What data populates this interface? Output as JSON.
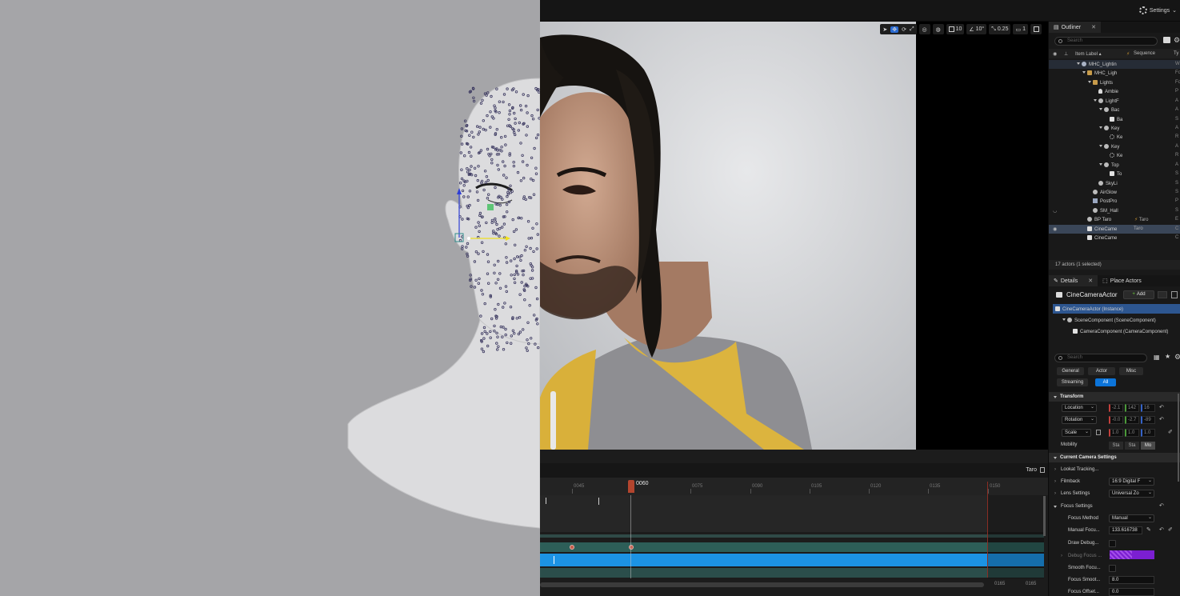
{
  "topbar": {
    "settings_label": "Settings"
  },
  "viewport": {
    "toolbar": {
      "grid_snap": "10",
      "rotate_snap": "10°",
      "scale_snap": "0.25",
      "camera_speed": "1"
    }
  },
  "sequencer": {
    "sequence_name": "Taro",
    "current_frame": "0060",
    "ticks": [
      "0045",
      "0075",
      "0090",
      "0105",
      "0120",
      "0135",
      "0150"
    ],
    "end_left": "0165",
    "end_right": "0165"
  },
  "outliner": {
    "tab_label": "Outliner",
    "search_placeholder": "Search",
    "col_item_label": "Item Label ▴",
    "col_sequence": "Sequence",
    "col_type": "Ty",
    "rows": [
      {
        "label": "MHC_Lightin",
        "type": "W",
        "seq": ""
      },
      {
        "label": "MHC_Ligh",
        "type": "Fo",
        "seq": ""
      },
      {
        "label": "Lights",
        "type": "Fo",
        "seq": ""
      },
      {
        "label": "Ambie",
        "type": "P",
        "seq": ""
      },
      {
        "label": "LightF",
        "type": "A",
        "seq": ""
      },
      {
        "label": "Bac",
        "type": "A",
        "seq": ""
      },
      {
        "label": "Ba",
        "type": "S",
        "seq": ""
      },
      {
        "label": "Key",
        "type": "A",
        "seq": ""
      },
      {
        "label": "Ke",
        "type": "R",
        "seq": ""
      },
      {
        "label": "Key",
        "type": "A",
        "seq": ""
      },
      {
        "label": "Ke",
        "type": "R",
        "seq": ""
      },
      {
        "label": "Top",
        "type": "A",
        "seq": ""
      },
      {
        "label": "To",
        "type": "S",
        "seq": ""
      },
      {
        "label": "SkyLi",
        "type": "S",
        "seq": ""
      },
      {
        "label": "AirGlow",
        "type": "S",
        "seq": ""
      },
      {
        "label": "PostPro",
        "type": "P",
        "seq": ""
      },
      {
        "label": "SM_Hall",
        "type": "S",
        "seq": ""
      },
      {
        "label": "BP Taro",
        "type": "E",
        "seq": "Taro"
      },
      {
        "label": "CineCame",
        "type": "C",
        "seq": "Taro"
      },
      {
        "label": "CineCame",
        "type": "C",
        "seq": ""
      }
    ],
    "actor_count": "17 actors (1 selected)"
  },
  "details": {
    "tab_label": "Details",
    "place_actors_label": "Place Actors",
    "actor_name": "CineCameraActor",
    "add_label": "Add",
    "components": [
      "CineCameraActor (Instance)",
      "SceneComponent (SceneComponent)",
      "CameraComponent (CameraComponent)"
    ],
    "search_placeholder": "Search",
    "filters": [
      "General",
      "Actor",
      "Misc",
      "Streaming",
      "All"
    ],
    "transform": {
      "section": "Transform",
      "location_label": "Location",
      "location": [
        "-2.1",
        "142",
        "16"
      ],
      "rotation_label": "Rotation",
      "rotation": [
        "-0.0",
        "-2.7",
        "-89"
      ],
      "scale_label": "Scale",
      "scale": [
        "1.0",
        "1.0",
        "1.0"
      ],
      "mobility_label": "Mobility",
      "mobility": [
        "Sta",
        "Sta",
        "Mo"
      ]
    },
    "camera": {
      "section": "Current Camera Settings",
      "lookat": "Lookat Tracking...",
      "filmback_label": "Filmback",
      "filmback_value": "16:9 Digital F",
      "lens_label": "Lens Settings",
      "lens_value": "Universal Zo",
      "focus_label": "Focus Settings",
      "focus_method_label": "Focus Method",
      "focus_method_value": "Manual",
      "manual_focus_label": "Manual Focu...",
      "manual_focus_value": "133.616738",
      "draw_debug_label": "Draw Debug...",
      "debug_focus_label": "Debug Focus ...",
      "smooth_focus_label": "Smooth Focu...",
      "focus_smooth_label": "Focus Smoot...",
      "focus_smooth_value": "8.0",
      "focus_offset_label": "Focus Offset...",
      "focus_offset_value": "0.0"
    }
  }
}
